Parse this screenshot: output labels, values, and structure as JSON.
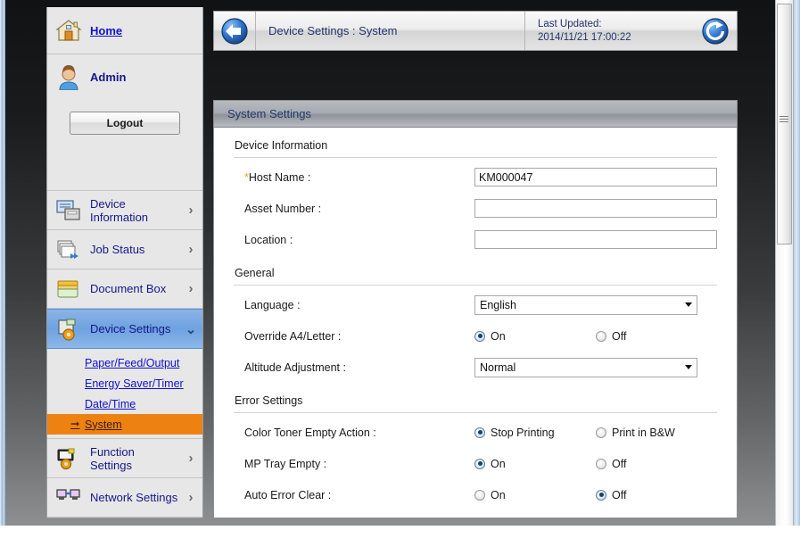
{
  "window": {
    "scrollbar_name": "vertical-scrollbar"
  },
  "sidebar": {
    "home_label": "Home",
    "user_label": "Admin",
    "logout_label": "Logout",
    "nav": [
      {
        "label": "Device Information",
        "icon": "device-information-icon",
        "chevron": "›",
        "active": false
      },
      {
        "label": "Job Status",
        "icon": "job-status-icon",
        "chevron": "›",
        "active": false
      },
      {
        "label": "Document Box",
        "icon": "document-box-icon",
        "chevron": "›",
        "active": false
      },
      {
        "label": "Device Settings",
        "icon": "device-settings-icon",
        "chevron": "⌄",
        "active": true
      }
    ],
    "sublinks": [
      {
        "label": "Paper/Feed/Output",
        "current": false
      },
      {
        "label": "Energy Saver/Timer",
        "current": false
      },
      {
        "label": "Date/Time",
        "current": false
      },
      {
        "label": "System",
        "current": true
      }
    ],
    "nav_bottom": [
      {
        "label": "Function Settings",
        "icon": "function-settings-icon",
        "chevron": "›",
        "active": false
      },
      {
        "label": "Network Settings",
        "icon": "network-settings-icon",
        "chevron": "›",
        "active": false
      }
    ]
  },
  "topbar": {
    "back_icon": "back-arrow-icon",
    "breadcrumb": "Device Settings : System",
    "last_updated_label": "Last Updated:",
    "last_updated_value": "2014/11/21 17:00:22",
    "refresh_icon": "refresh-icon"
  },
  "panel": {
    "title": "System Settings",
    "sections": [
      {
        "title": "Device Information",
        "rows": [
          {
            "label": "Host Name :",
            "required": true,
            "type": "text",
            "value": "KM000047"
          },
          {
            "label": "Asset Number :",
            "required": false,
            "type": "text",
            "value": ""
          },
          {
            "label": "Location :",
            "required": false,
            "type": "text",
            "value": ""
          }
        ]
      },
      {
        "title": "General",
        "rows": [
          {
            "label": "Language :",
            "required": false,
            "type": "select",
            "value": "English"
          },
          {
            "label": "Override A4/Letter :",
            "required": false,
            "type": "radio",
            "options": [
              {
                "label": "On",
                "selected": true
              },
              {
                "label": "Off",
                "selected": false
              }
            ]
          },
          {
            "label": "Altitude Adjustment :",
            "required": false,
            "type": "select",
            "value": "Normal"
          }
        ]
      },
      {
        "title": "Error Settings",
        "rows": [
          {
            "label": "Color Toner Empty Action :",
            "required": false,
            "type": "radio",
            "options": [
              {
                "label": "Stop Printing",
                "selected": true
              },
              {
                "label": "Print in B&W",
                "selected": false
              }
            ]
          },
          {
            "label": "MP Tray Empty :",
            "required": false,
            "type": "radio",
            "options": [
              {
                "label": "On",
                "selected": true
              },
              {
                "label": "Off",
                "selected": false
              }
            ]
          },
          {
            "label": "Auto Error Clear :",
            "required": false,
            "type": "radio",
            "options": [
              {
                "label": "On",
                "selected": false
              },
              {
                "label": "Off",
                "selected": true
              }
            ]
          }
        ]
      }
    ]
  },
  "colors": {
    "link": "#1111cc",
    "heading": "#21386e",
    "active_nav": "#6fa2e0",
    "current_sublink": "#ed8213",
    "required_star": "#e8a317",
    "radio_selected": "#16406e"
  }
}
